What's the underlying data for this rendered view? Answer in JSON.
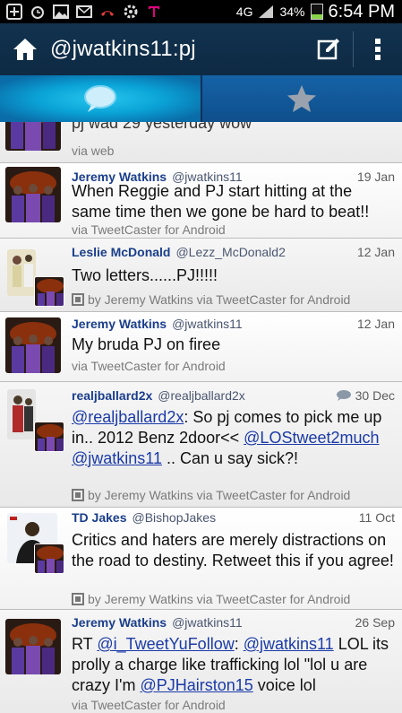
{
  "status": {
    "network": "4G",
    "battery": "34%",
    "battery_level": 0.34,
    "time": "6:54 PM"
  },
  "appbar": {
    "title": "@jwatkins11:pj",
    "icons": [
      "home-icon",
      "compose-icon",
      "overflow-menu-icon"
    ]
  },
  "tabs": [
    {
      "icon": "speech-bubble-icon",
      "active": true
    },
    {
      "icon": "star-icon",
      "active": false
    }
  ],
  "colors": {
    "name": "#1a3e8c",
    "link": "#1a3aa8",
    "appbar": "#12324e",
    "tab_active": "#0aa2d6"
  },
  "tweets": [
    {
      "name": "",
      "handle": "",
      "date": "",
      "body": "pj wad 29 yesterday wow",
      "source": "via web"
    },
    {
      "name": "Jeremy Watkins",
      "handle": "@jwatkins11",
      "date": "19 Jan",
      "body": "When Reggie and PJ start hitting at the same time then we gone be hard to beat!!",
      "source": "via TweetCaster for Android"
    },
    {
      "name": "Leslie McDonald",
      "handle": "@Lezz_McDonald2",
      "date": "12 Jan",
      "body": "Two letters......PJ!!!!!",
      "source": "by Jeremy Watkins via TweetCaster for Android"
    },
    {
      "name": "Jeremy Watkins",
      "handle": "@jwatkins11",
      "date": "12 Jan",
      "body": "My bruda PJ on firee",
      "source": "via TweetCaster for Android"
    },
    {
      "name": "realjballard2x",
      "handle": "@realjballard2x",
      "date": "30 Dec",
      "body_parts": {
        "m1": "@realjballard2x",
        "t1": ": So pj comes to pick me up in.. 2012 Benz 2door<< ",
        "m2": "@LOStweet2much",
        "t2": " ",
        "m3": "@jwatkins11",
        "t3": " .. Can u say sick?!"
      },
      "source": "by Jeremy Watkins via TweetCaster for Android"
    },
    {
      "name": "TD Jakes",
      "handle": "@BishopJakes",
      "date": "11 Oct",
      "body": "Critics and haters are merely distractions on the road to destiny. Retweet this if you agree!",
      "source": "by Jeremy Watkins via TweetCaster for Android"
    },
    {
      "name": "Jeremy Watkins",
      "handle": "@jwatkins11",
      "date": "26 Sep",
      "body_parts": {
        "t0": "RT ",
        "m1": "@i_TweetYuFollow",
        "t1": ": ",
        "m2": "@jwatkins11",
        "t2": " LOL its prolly a charge like trafficking lol \"lol u are crazy I'm ",
        "m3": "@PJHairston15",
        "t3": " voice lol"
      },
      "source": "via TweetCaster for Android"
    }
  ]
}
